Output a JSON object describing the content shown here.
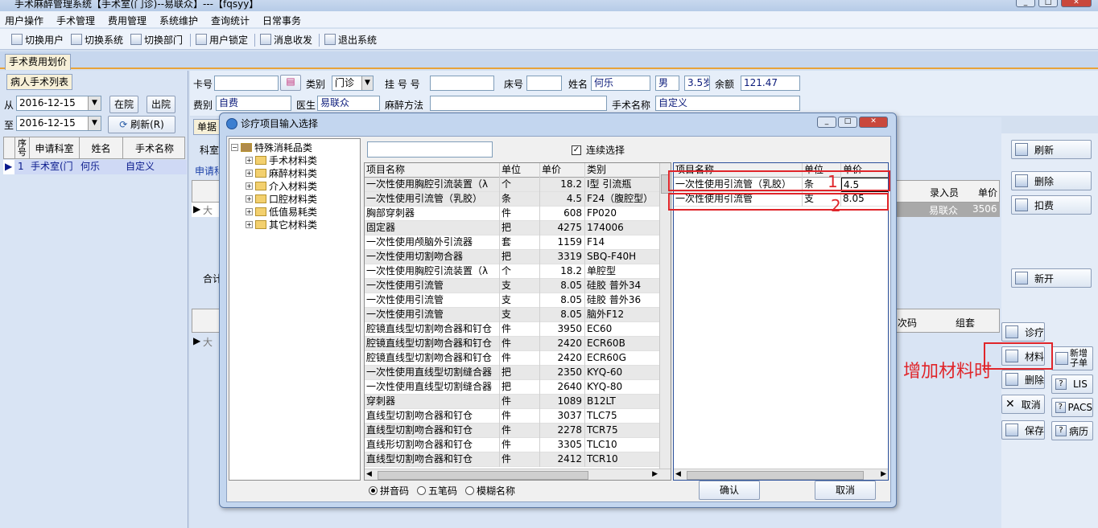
{
  "window": {
    "title": "手术麻醉管理系统【手术室(门诊)--易联众】---【fqsyy】"
  },
  "menu": [
    "用户操作",
    "手术管理",
    "费用管理",
    "系统维护",
    "查询统计",
    "日常事务"
  ],
  "toolbar": [
    "切换用户",
    "切换系统",
    "切换部门",
    "用户锁定",
    "消息收发",
    "退出系统"
  ],
  "main_tab": "手术费用划价",
  "left_panel": {
    "tab": "病人手术列表",
    "from_label": "从",
    "from_date": "2016-12-15",
    "to_label": "至",
    "to_date": "2016-12-15",
    "btn_in": "在院",
    "btn_out": "出院",
    "btn_refresh": "刷新(R)",
    "columns": [
      "序号",
      "申请科室",
      "姓名",
      "手术名称"
    ],
    "rows": [
      {
        "no": "1",
        "dept": "手术室(门",
        "name": "何乐",
        "op": "自定义"
      }
    ]
  },
  "patient": {
    "card_label": "卡号",
    "card_value": "",
    "category_label": "类别",
    "category_value": "门诊",
    "reg_label": "挂 号 号",
    "reg_value": "",
    "bed_label": "床号",
    "bed_value": "",
    "name_label": "姓名",
    "name_value": "何乐",
    "sex_value": "男",
    "age_value": "3.5岁",
    "balance_label": "余额",
    "balance_value": "121.47",
    "fee_label": "费别",
    "fee_value": "自费",
    "doctor_label": "医生",
    "doctor_value": "易联众",
    "anesth_label": "麻醉方法",
    "anesth_value": "",
    "op_label": "手术名称",
    "op_value": "自定义"
  },
  "background": {
    "tab_bill": "单据",
    "dept": "科室",
    "apply": "申请科",
    "row_da1": "大",
    "row_da2": "大",
    "total": "合计",
    "col_entry": "录入员",
    "col_price": "单价",
    "entry_value": "易联众",
    "price_value": "3506",
    "col_times": "次码",
    "col_set": "组套"
  },
  "right_buttons": {
    "refresh": "刷新",
    "delete": "删除",
    "deduct": "扣费",
    "new_open": "新开",
    "treat": "诊疗",
    "material": "材料",
    "new_sub": "新增子单",
    "delete2": "删除",
    "lis": "LIS",
    "cancel": "取消",
    "pacs": "PACS",
    "save": "保存",
    "history": "病历"
  },
  "annotation": {
    "text": "增加材料时",
    "marker1": "1",
    "marker2": "2",
    "color": "#e0252a"
  },
  "dialog": {
    "title": "诊疗项目输入选择",
    "search_value": "",
    "continuous_label": "连续选择",
    "continuous_checked": true,
    "tree_root": "特殊消耗品类",
    "tree_items": [
      "手术材料类",
      "麻醉材料类",
      "介入材料类",
      "口腔材料类",
      "低值易耗类",
      "其它材料类"
    ],
    "left_columns": [
      "项目名称",
      "单位",
      "单价",
      "类别"
    ],
    "left_rows": [
      {
        "name": "一次性使用胸腔引流装置（λ",
        "unit": "个",
        "price": "18.2",
        "cat": "I型 引流瓶"
      },
      {
        "name": "一次性使用引流管（乳胶）",
        "unit": "条",
        "price": "4.5",
        "cat": "F24（腹腔型）"
      },
      {
        "name": "胸部穿刺器",
        "unit": "件",
        "price": "608",
        "cat": "FP020"
      },
      {
        "name": "固定器",
        "unit": "把",
        "price": "4275",
        "cat": "174006"
      },
      {
        "name": "一次性使用颅脑外引流器",
        "unit": "套",
        "price": "1159",
        "cat": "F14"
      },
      {
        "name": "一次性使用切割吻合器",
        "unit": "把",
        "price": "3319",
        "cat": "SBQ-F40H"
      },
      {
        "name": "一次性使用胸腔引流装置（λ",
        "unit": "个",
        "price": "18.2",
        "cat": "单腔型"
      },
      {
        "name": "一次性使用引流管",
        "unit": "支",
        "price": "8.05",
        "cat": "硅胶 普外34"
      },
      {
        "name": "一次性使用引流管",
        "unit": "支",
        "price": "8.05",
        "cat": "硅胶 普外36"
      },
      {
        "name": "一次性使用引流管",
        "unit": "支",
        "price": "8.05",
        "cat": "脑外F12"
      },
      {
        "name": "腔镜直线型切割吻合器和钉仓",
        "unit": "件",
        "price": "3950",
        "cat": "EC60"
      },
      {
        "name": "腔镜直线型切割吻合器和钉仓",
        "unit": "件",
        "price": "2420",
        "cat": "ECR60B"
      },
      {
        "name": "腔镜直线型切割吻合器和钉仓",
        "unit": "件",
        "price": "2420",
        "cat": "ECR60G"
      },
      {
        "name": "一次性使用直线型切割缝合器",
        "unit": "把",
        "price": "2350",
        "cat": "KYQ-60"
      },
      {
        "name": "一次性使用直线型切割缝合器",
        "unit": "把",
        "price": "2640",
        "cat": "KYQ-80"
      },
      {
        "name": "穿刺器",
        "unit": "件",
        "price": "1089",
        "cat": "B12LT"
      },
      {
        "name": "直线型切割吻合器和钉仓",
        "unit": "件",
        "price": "3037",
        "cat": "TLC75"
      },
      {
        "name": "直线型切割吻合器和钉仓",
        "unit": "件",
        "price": "2278",
        "cat": "TCR75"
      },
      {
        "name": "直线形切割吻合器和钉仓",
        "unit": "件",
        "price": "3305",
        "cat": "TLC10"
      },
      {
        "name": "直线型切割吻合器和钉仓",
        "unit": "件",
        "price": "2412",
        "cat": "TCR10"
      }
    ],
    "right_columns": [
      "项目名称",
      "单位",
      "单价"
    ],
    "right_rows": [
      {
        "name": "一次性使用引流管（乳胶）",
        "unit": "条",
        "price": "4.5"
      },
      {
        "name": "一次性使用引流管",
        "unit": "支",
        "price": "8.05"
      }
    ],
    "radio": [
      "拼音码",
      "五笔码",
      "模糊名称"
    ],
    "radio_selected": 0,
    "ok": "确认",
    "cancel": "取消"
  }
}
